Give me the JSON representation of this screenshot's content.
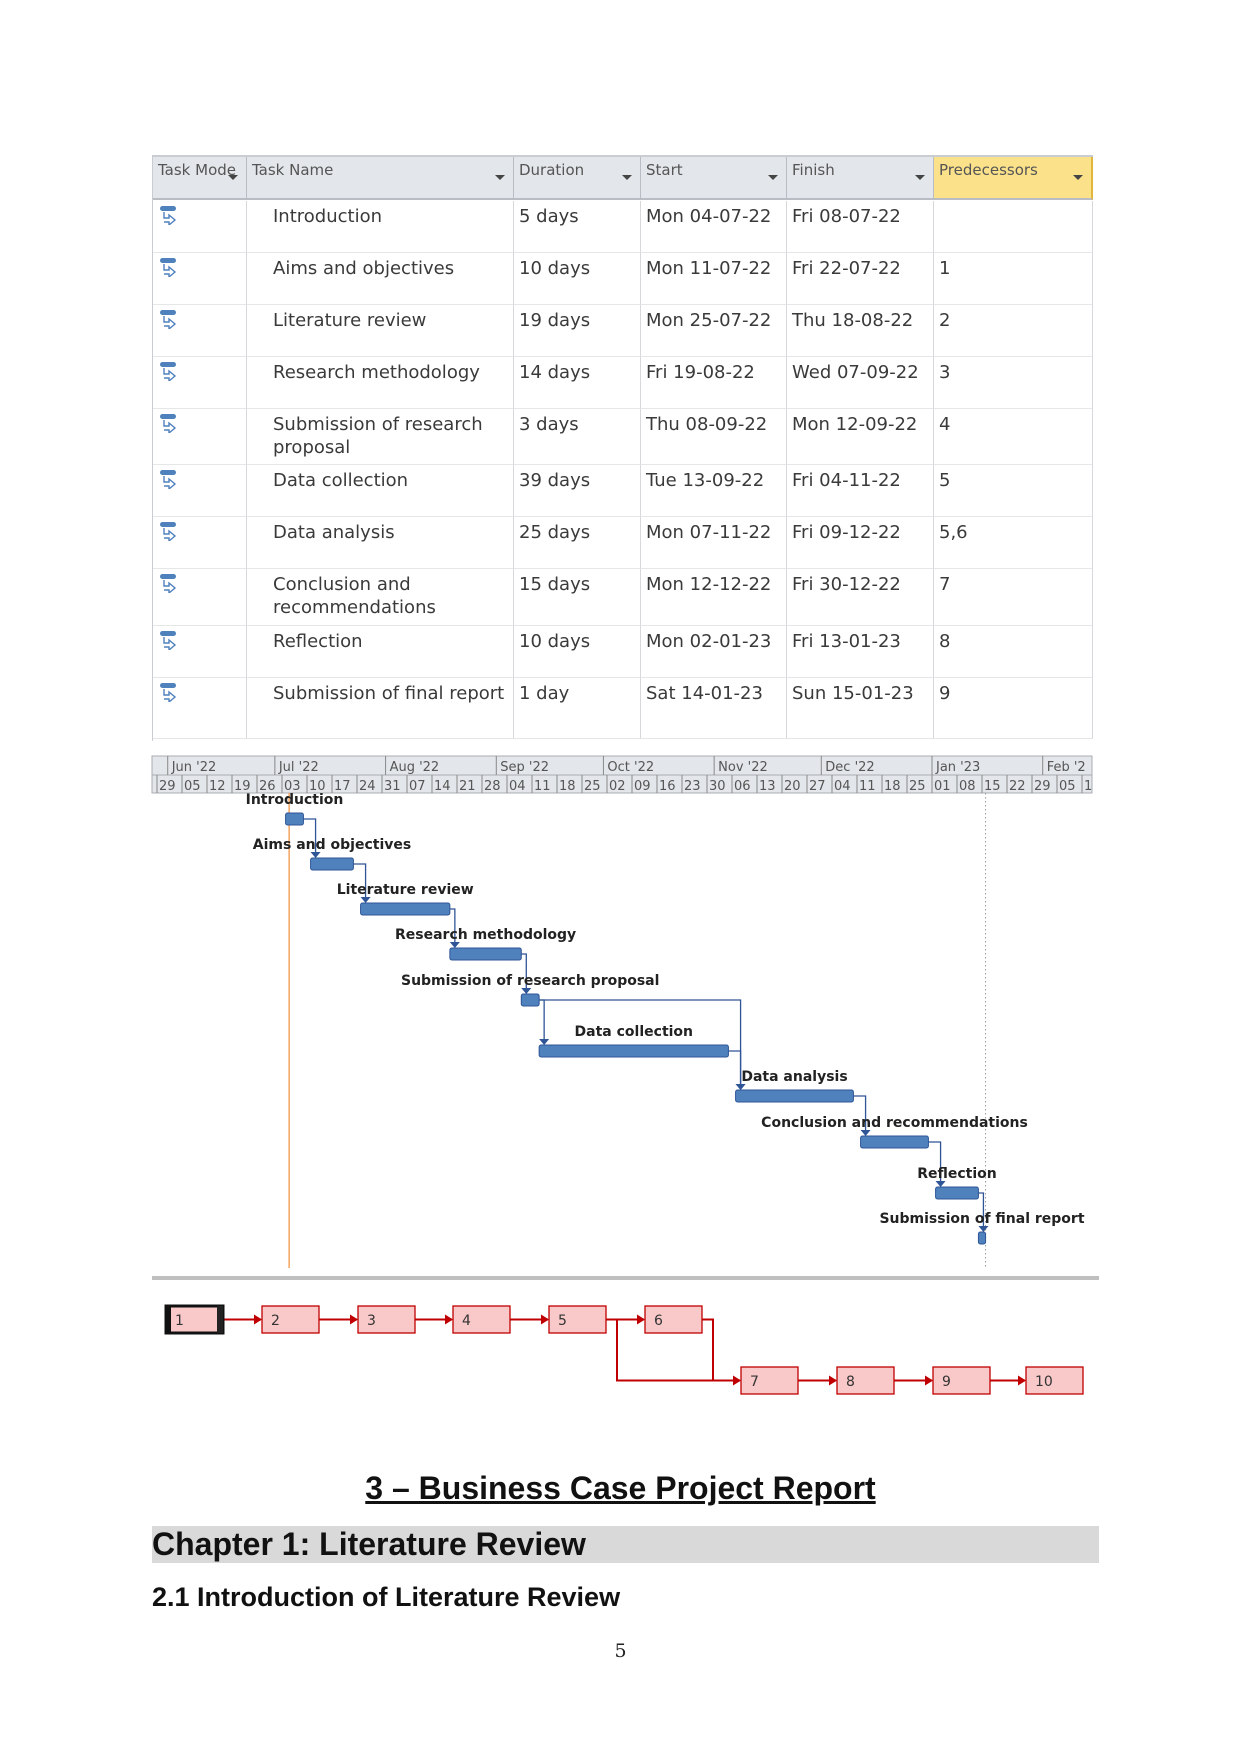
{
  "table": {
    "headers": [
      "Task Mode",
      "Task Name",
      "Duration",
      "Start",
      "Finish",
      "Predecessors"
    ],
    "header_highlight_color": "#fbe28a",
    "rows": [
      {
        "mode_icon": "auto-scheduled-task-icon",
        "name": "Introduction",
        "duration": "5 days",
        "start": "Mon 04-07-22",
        "finish": "Fri 08-07-22",
        "predecessors": ""
      },
      {
        "mode_icon": "auto-scheduled-task-icon",
        "name": "Aims and objectives",
        "duration": "10 days",
        "start": "Mon 11-07-22",
        "finish": "Fri 22-07-22",
        "predecessors": "1"
      },
      {
        "mode_icon": "auto-scheduled-task-icon",
        "name": "Literature review",
        "duration": "19 days",
        "start": "Mon 25-07-22",
        "finish": "Thu 18-08-22",
        "predecessors": "2"
      },
      {
        "mode_icon": "auto-scheduled-task-icon",
        "name": "Research methodology",
        "duration": "14 days",
        "start": "Fri 19-08-22",
        "finish": "Wed 07-09-22",
        "predecessors": "3"
      },
      {
        "mode_icon": "auto-scheduled-task-icon",
        "name": "Submission of research proposal",
        "duration": "3 days",
        "start": "Thu 08-09-22",
        "finish": "Mon 12-09-22",
        "predecessors": "4"
      },
      {
        "mode_icon": "auto-scheduled-task-icon",
        "name": "Data collection",
        "duration": "39 days",
        "start": "Tue 13-09-22",
        "finish": "Fri 04-11-22",
        "predecessors": "5"
      },
      {
        "mode_icon": "auto-scheduled-task-icon",
        "name": "Data analysis",
        "duration": "25 days",
        "start": "Mon 07-11-22",
        "finish": "Fri 09-12-22",
        "predecessors": "5,6"
      },
      {
        "mode_icon": "auto-scheduled-task-icon",
        "name": "Conclusion and recommendations",
        "duration": "15 days",
        "start": "Mon 12-12-22",
        "finish": "Fri 30-12-22",
        "predecessors": "7"
      },
      {
        "mode_icon": "auto-scheduled-task-icon",
        "name": "Reflection",
        "duration": "10 days",
        "start": "Mon 02-01-23",
        "finish": "Fri 13-01-23",
        "predecessors": "8"
      },
      {
        "mode_icon": "auto-scheduled-task-icon",
        "name": "Submission of final report",
        "duration": "1 day",
        "start": "Sat 14-01-23",
        "finish": "Sun 15-01-23",
        "predecessors": "9"
      }
    ]
  },
  "chart_data": {
    "type": "gantt",
    "timescale_months": [
      "Jun '22",
      "Jul '22",
      "Aug '22",
      "Sep '22",
      "Oct '22",
      "Nov '22",
      "Dec '22",
      "Jan '23",
      "Feb '2"
    ],
    "timescale_weeks": [
      "29",
      "05",
      "12",
      "19",
      "26",
      "03",
      "10",
      "17",
      "24",
      "31",
      "07",
      "14",
      "21",
      "28",
      "04",
      "11",
      "18",
      "25",
      "02",
      "09",
      "16",
      "23",
      "30",
      "06",
      "13",
      "20",
      "27",
      "04",
      "11",
      "18",
      "25",
      "01",
      "08",
      "15",
      "22",
      "29",
      "05",
      "1"
    ],
    "axis_start": "2022-05-29",
    "tasks": [
      {
        "label": "Introduction",
        "start": "2022-07-04",
        "finish": "2022-07-08",
        "predecessors": []
      },
      {
        "label": "Aims and objectives",
        "start": "2022-07-11",
        "finish": "2022-07-22",
        "predecessors": [
          1
        ]
      },
      {
        "label": "Literature review",
        "start": "2022-07-25",
        "finish": "2022-08-18",
        "predecessors": [
          2
        ]
      },
      {
        "label": "Research methodology",
        "start": "2022-08-19",
        "finish": "2022-09-07",
        "predecessors": [
          3
        ]
      },
      {
        "label": "Submission of research proposal",
        "start": "2022-09-08",
        "finish": "2022-09-12",
        "predecessors": [
          4
        ]
      },
      {
        "label": "Data collection",
        "start": "2022-09-13",
        "finish": "2022-11-04",
        "predecessors": [
          5
        ]
      },
      {
        "label": "Data analysis",
        "start": "2022-11-07",
        "finish": "2022-12-09",
        "predecessors": [
          5,
          6
        ]
      },
      {
        "label": "Conclusion and recommendations",
        "start": "2022-12-12",
        "finish": "2022-12-30",
        "predecessors": [
          7
        ]
      },
      {
        "label": "Reflection",
        "start": "2023-01-02",
        "finish": "2023-01-13",
        "predecessors": [
          8
        ]
      },
      {
        "label": "Submission of final report",
        "start": "2023-01-14",
        "finish": "2023-01-15",
        "predecessors": [
          9
        ]
      }
    ],
    "today_line_date": "2022-07-05",
    "deadline_line_date": "2023-01-15",
    "colors": {
      "bar": "#4f81bd",
      "bar_border": "#2f5597",
      "link": "#2f5597",
      "today_line": "#f4a460"
    }
  },
  "network": {
    "nodes": [
      "1",
      "2",
      "3",
      "4",
      "5",
      "6",
      "7",
      "8",
      "9",
      "10"
    ],
    "selected": "1",
    "colors": {
      "fill": "#f9c9c9",
      "border": "#c00000",
      "link": "#c00000"
    }
  },
  "document": {
    "title": "3 – Business Case Project Report",
    "chapter": "Chapter 1: Literature Review",
    "section": "2.1 Introduction of Literature Review",
    "page_number": "5"
  }
}
